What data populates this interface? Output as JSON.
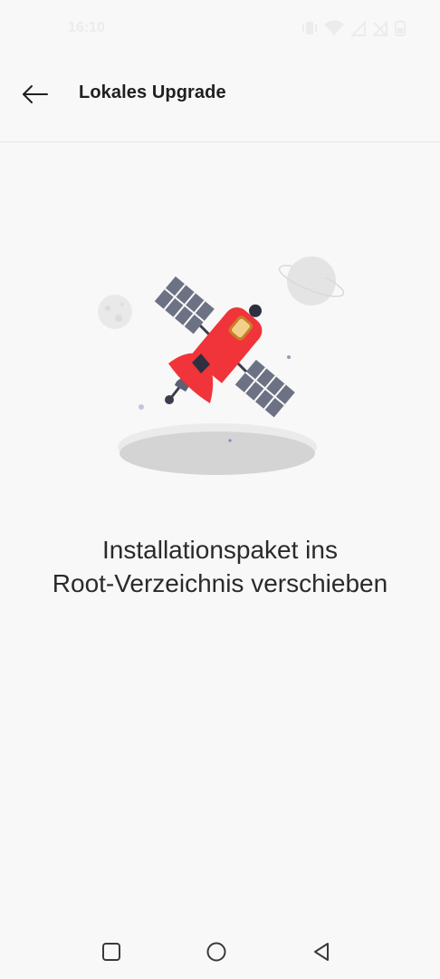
{
  "status_bar": {
    "time": "16:10",
    "icons": [
      "vibrate-icon",
      "wifi-icon",
      "signal-icon",
      "no-sim-icon",
      "battery-icon"
    ]
  },
  "header": {
    "title": "Lokales Upgrade",
    "back_icon": "arrow-left-icon"
  },
  "main": {
    "message_line1": "Installationspaket ins",
    "message_line2": "Root-Verzeichnis verschieben",
    "illustration": "satellite-illustration"
  },
  "navigation": {
    "recents_icon": "square-icon",
    "home_icon": "circle-icon",
    "back_icon": "triangle-back-icon"
  },
  "colors": {
    "background": "#f8f8f8",
    "accent_red": "#f0343a",
    "panel_gray": "#6d7184",
    "planet_gray": "#e4e4e4"
  }
}
